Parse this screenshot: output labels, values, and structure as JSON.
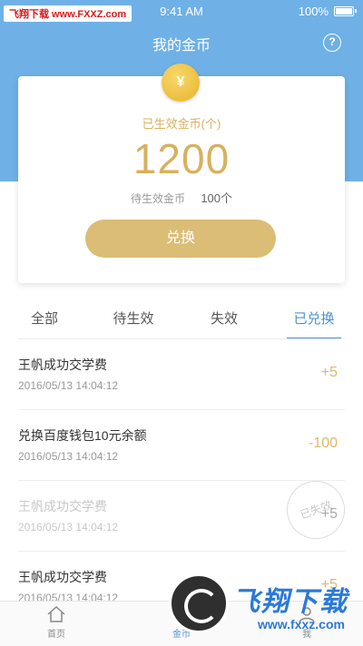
{
  "status_bar": {
    "watermark": "飞翔下载 www.FXXZ.com",
    "time": "9:41 AM",
    "battery": "100%"
  },
  "header": {
    "title": "我的金币",
    "help_icon": "question-circle-icon",
    "bg_color": "#6fb1e6"
  },
  "card": {
    "coin_symbol": "¥",
    "effective_label": "已生效金币(个)",
    "effective_value": "1200",
    "pending_label": "待生效金币",
    "pending_value": "100个",
    "exchange_label": "兑换",
    "accent_color": "#dcbd76"
  },
  "tabs": [
    {
      "label": "全部",
      "active": false
    },
    {
      "label": "待生效",
      "active": false
    },
    {
      "label": "失效",
      "active": false
    },
    {
      "label": "已兑换",
      "active": true
    }
  ],
  "records": [
    {
      "title": "王帆成功交学费",
      "date": "2016/05/13 14:04:12",
      "amount": "+5",
      "expired": false
    },
    {
      "title": "兑换百度钱包10元余额",
      "date": "2016/05/13 14:04:12",
      "amount": "-100",
      "expired": false
    },
    {
      "title": "王帆成功交学费",
      "date": "2016/05/13 14:04:12",
      "amount": "+5",
      "expired": true,
      "stamp": "已失效"
    },
    {
      "title": "王帆成功交学费",
      "date": "2016/05/13 14:04:12",
      "amount": "+5",
      "expired": false
    }
  ],
  "bottom_nav": [
    {
      "label": "首页",
      "icon": "home-icon",
      "active": false
    },
    {
      "label": "金币",
      "icon": "coin-icon",
      "active": true
    },
    {
      "label": "我",
      "icon": "user-icon",
      "active": false
    }
  ],
  "watermark_logo": {
    "text": "飞翔下载",
    "url": "www.fxxz.com"
  }
}
